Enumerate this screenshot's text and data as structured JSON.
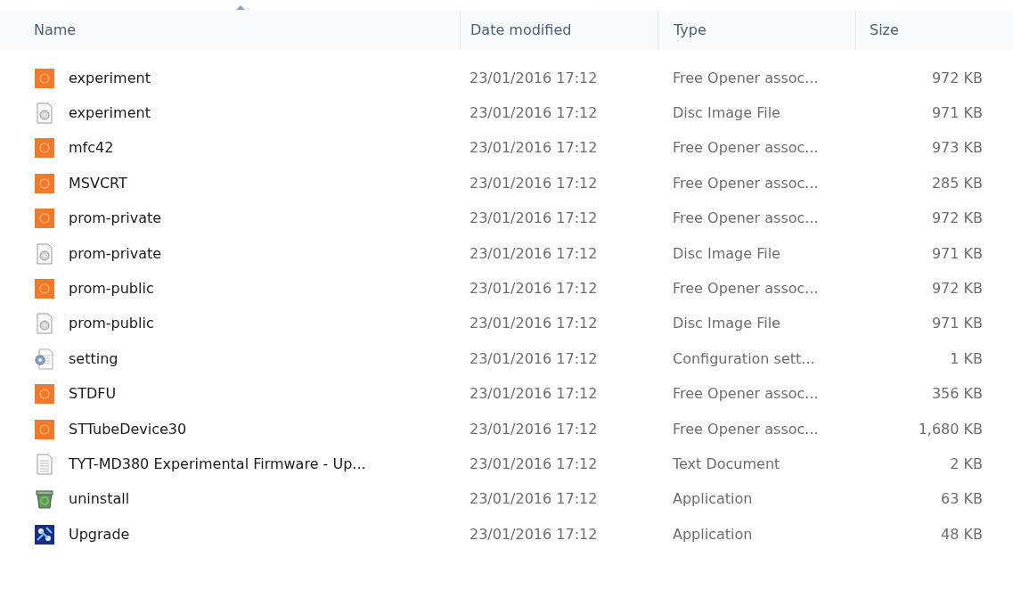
{
  "columns": [
    {
      "label": "Name",
      "sorted": true
    },
    {
      "label": "Date modified",
      "sorted": false
    },
    {
      "label": "Type",
      "sorted": false
    },
    {
      "label": "Size",
      "sorted": false
    }
  ],
  "rows": [
    {
      "kind": "opener",
      "name": "experiment",
      "date": "23/01/2016 17:12",
      "type": "Free Opener assoc...",
      "size": "972 KB"
    },
    {
      "kind": "disc",
      "name": "experiment",
      "date": "23/01/2016 17:12",
      "type": "Disc Image File",
      "size": "971 KB"
    },
    {
      "kind": "opener",
      "name": "mfc42",
      "date": "23/01/2016 17:12",
      "type": "Free Opener assoc...",
      "size": "973 KB"
    },
    {
      "kind": "opener",
      "name": "MSVCRT",
      "date": "23/01/2016 17:12",
      "type": "Free Opener assoc...",
      "size": "285 KB"
    },
    {
      "kind": "opener",
      "name": "prom-private",
      "date": "23/01/2016 17:12",
      "type": "Free Opener assoc...",
      "size": "972 KB"
    },
    {
      "kind": "disc",
      "name": "prom-private",
      "date": "23/01/2016 17:12",
      "type": "Disc Image File",
      "size": "971 KB"
    },
    {
      "kind": "opener",
      "name": "prom-public",
      "date": "23/01/2016 17:12",
      "type": "Free Opener assoc...",
      "size": "972 KB"
    },
    {
      "kind": "disc",
      "name": "prom-public",
      "date": "23/01/2016 17:12",
      "type": "Disc Image File",
      "size": "971 KB"
    },
    {
      "kind": "config",
      "name": "setting",
      "date": "23/01/2016 17:12",
      "type": "Configuration sett...",
      "size": "1 KB"
    },
    {
      "kind": "opener",
      "name": "STDFU",
      "date": "23/01/2016 17:12",
      "type": "Free Opener assoc...",
      "size": "356 KB"
    },
    {
      "kind": "opener",
      "name": "STTubeDevice30",
      "date": "23/01/2016 17:12",
      "type": "Free Opener assoc...",
      "size": "1,680 KB"
    },
    {
      "kind": "text",
      "name": "TYT-MD380 Experimental Firmware - Up...",
      "date": "23/01/2016 17:12",
      "type": "Text Document",
      "size": "2 KB"
    },
    {
      "kind": "uninstall",
      "name": "uninstall",
      "date": "23/01/2016 17:12",
      "type": "Application",
      "size": "63 KB"
    },
    {
      "kind": "upgrade",
      "name": "Upgrade",
      "date": "23/01/2016 17:12",
      "type": "Application",
      "size": "48 KB"
    }
  ]
}
